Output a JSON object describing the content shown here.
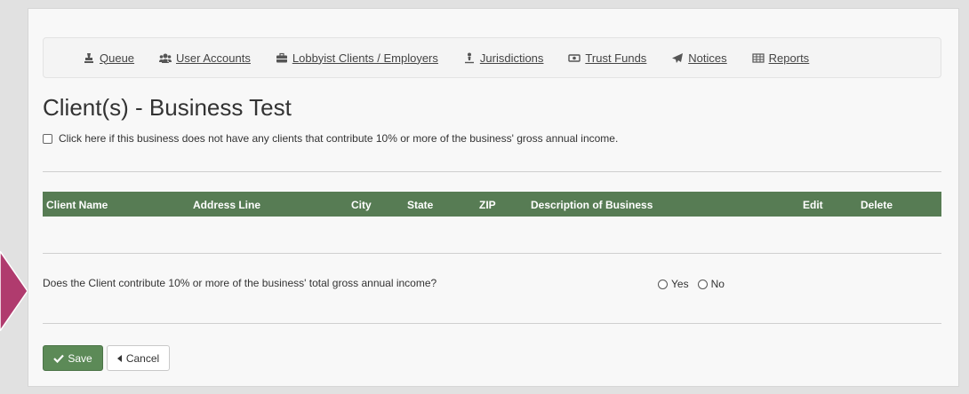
{
  "nav": {
    "items": [
      {
        "label": "Queue",
        "icon": "stamp-icon"
      },
      {
        "label": "User Accounts",
        "icon": "users-icon"
      },
      {
        "label": "Lobbyist Clients / Employers",
        "icon": "briefcase-icon"
      },
      {
        "label": "Jurisdictions",
        "icon": "person-pin-icon"
      },
      {
        "label": "Trust Funds",
        "icon": "money-icon"
      },
      {
        "label": "Notices",
        "icon": "paper-plane-icon"
      },
      {
        "label": "Reports",
        "icon": "table-icon"
      }
    ]
  },
  "page": {
    "title": "Client(s) - Business Test",
    "checkbox_label": "Click here if this business does not have any clients that contribute 10% or more of the business' gross annual income."
  },
  "table": {
    "columns": [
      "Client Name",
      "Address Line",
      "City",
      "State",
      "ZIP",
      "Description of Business",
      "Edit",
      "Delete"
    ],
    "header_color": "#577c54",
    "rows": []
  },
  "question": {
    "text": "Does the Client contribute 10% or more of the business' total gross annual income?",
    "options": [
      "Yes",
      "No"
    ]
  },
  "actions": {
    "save_label": "Save",
    "cancel_label": "Cancel",
    "save_color": "#5c8a57"
  },
  "theme": {
    "arrow_color": "#b03b6e"
  }
}
